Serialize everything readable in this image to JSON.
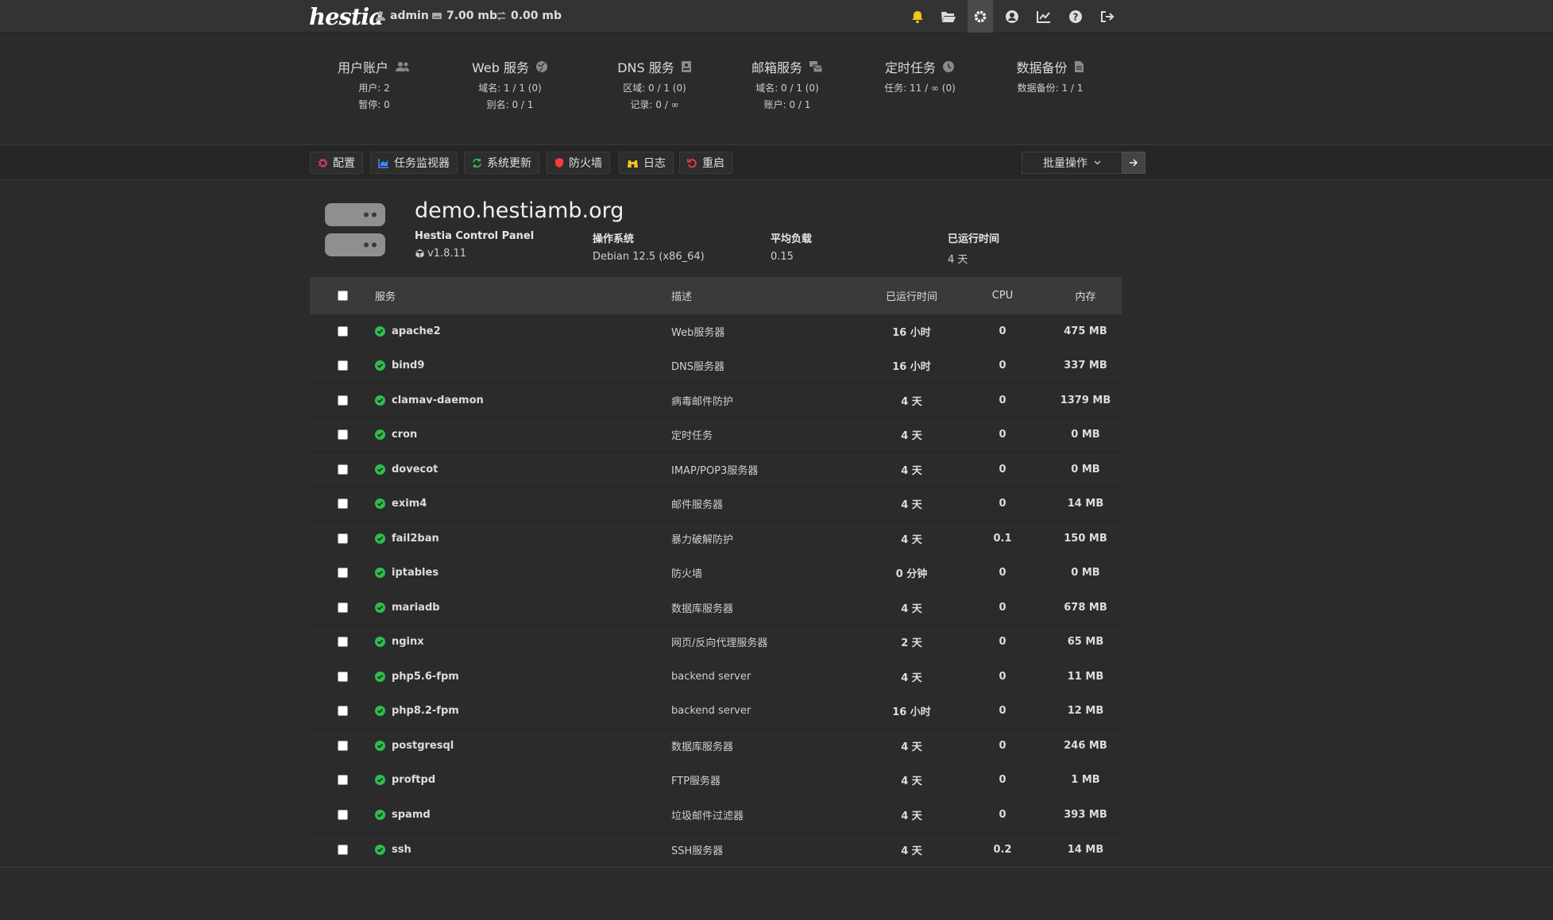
{
  "topbar": {
    "logo": "hestia",
    "user": "admin",
    "disk": "7.00 mb",
    "bandwidth": "0.00 mb",
    "icons": [
      "bell-icon",
      "folder-open-icon",
      "gear-icon",
      "user-circle-icon",
      "chart-line-icon",
      "question-icon",
      "logout-icon"
    ]
  },
  "stats": [
    {
      "title": "用户账户",
      "icon": "users-icon",
      "lines": [
        "用户: 2",
        "暂停: 0"
      ]
    },
    {
      "title": "Web 服务",
      "icon": "globe-icon",
      "lines": [
        "域名: 1 / 1 (0)",
        "别名: 0 / 1"
      ]
    },
    {
      "title": "DNS 服务",
      "icon": "dns-book-icon",
      "lines": [
        "区域: 0 / 1 (0)",
        "记录: 0 / ∞"
      ]
    },
    {
      "title": "邮箱服务",
      "icon": "mail-bulk-icon",
      "lines": [
        "域名: 0 / 1 (0)",
        "账户: 0 / 1"
      ]
    },
    {
      "title": "定时任务",
      "icon": "clock-icon",
      "lines": [
        "任务: 11 / ∞ (0)"
      ]
    },
    {
      "title": "数据备份",
      "icon": "file-icon",
      "lines": [
        "数据备份: 1 / 1"
      ]
    }
  ],
  "toolbar": {
    "buttons": [
      {
        "label": "配置",
        "icon": "gear-icon",
        "color": "#ff3d7f"
      },
      {
        "label": "任务监视器",
        "icon": "chart-area-icon",
        "color": "#3d8bff"
      },
      {
        "label": "系统更新",
        "icon": "refresh-icon",
        "color": "#2ebd4e"
      },
      {
        "label": "防火墙",
        "icon": "shield-icon",
        "color": "#ff3b3b"
      },
      {
        "label": "日志",
        "icon": "binoculars-icon",
        "color": "#f5c518"
      },
      {
        "label": "重启",
        "icon": "undo-icon",
        "color": "#ff3b3b"
      }
    ],
    "bulk_label": "批量操作"
  },
  "server": {
    "hostname": "demo.hestiamb.org",
    "panel_label": "Hestia Control Panel",
    "panel_version": "v1.8.11",
    "os_label": "操作系统",
    "os_value": "Debian 12.5 (x86_64)",
    "load_label": "平均负载",
    "load_value": "0.15",
    "uptime_label": "已运行时间",
    "uptime_value": "4 天"
  },
  "table": {
    "headers": {
      "service": "服务",
      "description": "描述",
      "uptime": "已运行时间",
      "cpu": "CPU",
      "memory": "内存"
    },
    "rows": [
      {
        "service": "apache2",
        "description": "Web服务器",
        "uptime": "16 小时",
        "cpu": "0",
        "memory": "475 MB"
      },
      {
        "service": "bind9",
        "description": "DNS服务器",
        "uptime": "16 小时",
        "cpu": "0",
        "memory": "337 MB"
      },
      {
        "service": "clamav-daemon",
        "description": "病毒邮件防护",
        "uptime": "4 天",
        "cpu": "0",
        "memory": "1379 MB"
      },
      {
        "service": "cron",
        "description": "定时任务",
        "uptime": "4 天",
        "cpu": "0",
        "memory": "0 MB"
      },
      {
        "service": "dovecot",
        "description": "IMAP/POP3服务器",
        "uptime": "4 天",
        "cpu": "0",
        "memory": "0 MB"
      },
      {
        "service": "exim4",
        "description": "邮件服务器",
        "uptime": "4 天",
        "cpu": "0",
        "memory": "14 MB"
      },
      {
        "service": "fail2ban",
        "description": "暴力破解防护",
        "uptime": "4 天",
        "cpu": "0.1",
        "memory": "150 MB"
      },
      {
        "service": "iptables",
        "description": "防火墙",
        "uptime": "0 分钟",
        "cpu": "0",
        "memory": "0 MB"
      },
      {
        "service": "mariadb",
        "description": "数据库服务器",
        "uptime": "4 天",
        "cpu": "0",
        "memory": "678 MB"
      },
      {
        "service": "nginx",
        "description": "网页/反向代理服务器",
        "uptime": "2 天",
        "cpu": "0",
        "memory": "65 MB"
      },
      {
        "service": "php5.6-fpm",
        "description": "backend server",
        "uptime": "4 天",
        "cpu": "0",
        "memory": "11 MB"
      },
      {
        "service": "php8.2-fpm",
        "description": "backend server",
        "uptime": "16 小时",
        "cpu": "0",
        "memory": "12 MB"
      },
      {
        "service": "postgresql",
        "description": "数据库服务器",
        "uptime": "4 天",
        "cpu": "0",
        "memory": "246 MB"
      },
      {
        "service": "proftpd",
        "description": "FTP服务器",
        "uptime": "4 天",
        "cpu": "0",
        "memory": "1 MB"
      },
      {
        "service": "spamd",
        "description": "垃圾邮件过滤器",
        "uptime": "4 天",
        "cpu": "0",
        "memory": "393 MB"
      },
      {
        "service": "ssh",
        "description": "SSH服务器",
        "uptime": "4 天",
        "cpu": "0.2",
        "memory": "14 MB"
      }
    ]
  },
  "colors": {
    "status_ok": "#2ebd4e",
    "notification": "#f5c518"
  }
}
